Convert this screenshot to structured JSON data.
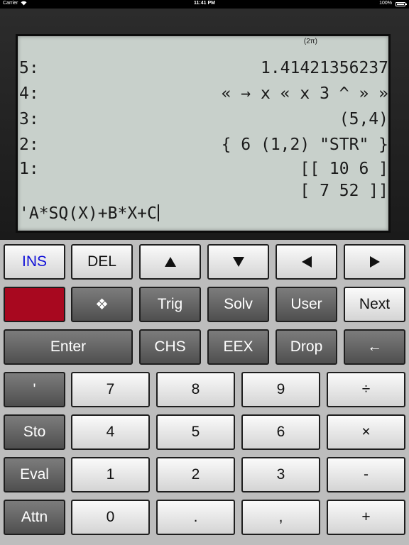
{
  "status_bar": {
    "carrier": "Carrier",
    "time": "11:41 PM",
    "battery": "100%"
  },
  "display": {
    "mode_indicator": "(2π)",
    "stack": [
      {
        "label": "5:",
        "value": "1.41421356237"
      },
      {
        "label": "4:",
        "value": "« → x « x 3 ^ » »"
      },
      {
        "label": "3:",
        "value": "(5,4)"
      },
      {
        "label": "2:",
        "value": "{ 6 (1,2) \"STR\" }"
      },
      {
        "label": "1:",
        "value": "[[ 10 6 ]",
        "value_line2": "[ 7 52 ]]"
      }
    ],
    "command_line": "'A*SQ(X)+B*X+C"
  },
  "keys": {
    "row1": {
      "ins": "INS",
      "del": "DEL",
      "up": "up-arrow-icon",
      "down": "down-arrow-icon",
      "left": "left-arrow-icon",
      "right": "right-arrow-icon"
    },
    "row2": {
      "shift_color": "#a8081f",
      "cursor_key": "❖",
      "trig": "Trig",
      "solv": "Solv",
      "user": "User",
      "next": "Next"
    },
    "row3": {
      "enter": "Enter",
      "chs": "CHS",
      "eex": "EEX",
      "drop": "Drop",
      "backspace": "←"
    },
    "row4": {
      "quote": "'",
      "seven": "7",
      "eight": "8",
      "nine": "9",
      "divide": "÷"
    },
    "row5": {
      "sto": "Sto",
      "four": "4",
      "five": "5",
      "six": "6",
      "multiply": "×"
    },
    "row6": {
      "eval": "Eval",
      "one": "1",
      "two": "2",
      "three": "3",
      "minus": "-"
    },
    "row7": {
      "attn": "Attn",
      "zero": "0",
      "dot": ".",
      "comma": ",",
      "plus": "+"
    }
  },
  "colors": {
    "ins_label": "#1010d8",
    "lcd_background": "#c8d0cb"
  }
}
